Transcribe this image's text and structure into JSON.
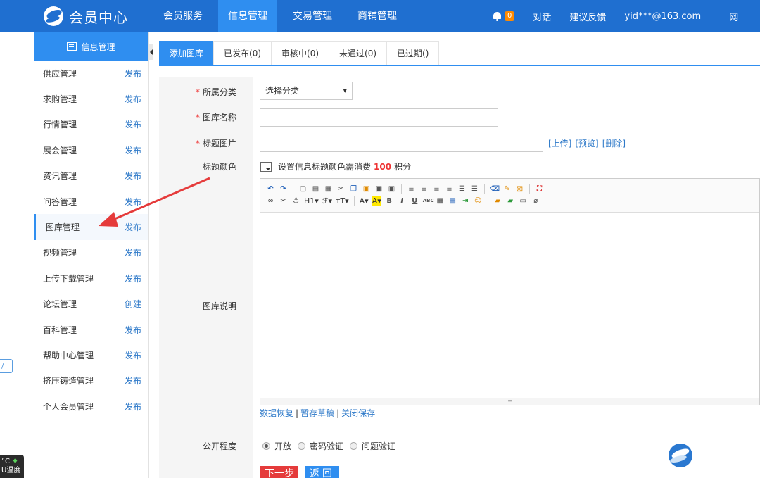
{
  "header": {
    "logo_text": "会员中心",
    "nav": [
      "会员服务",
      "信息管理",
      "交易管理",
      "商铺管理"
    ],
    "active_nav": "信息管理",
    "notification_count": "0",
    "chat": "对话",
    "feedback": "建议反馈",
    "user": "yid***@163.com",
    "overflow_char": "网"
  },
  "sidebar": {
    "title": "信息管理",
    "items": [
      {
        "label": "供应管理",
        "action": "发布"
      },
      {
        "label": "求购管理",
        "action": "发布"
      },
      {
        "label": "行情管理",
        "action": "发布"
      },
      {
        "label": "展会管理",
        "action": "发布"
      },
      {
        "label": "资讯管理",
        "action": "发布"
      },
      {
        "label": "问答管理",
        "action": "发布"
      },
      {
        "label": "图库管理",
        "action": "发布"
      },
      {
        "label": "视频管理",
        "action": "发布"
      },
      {
        "label": "上传下载管理",
        "action": "发布"
      },
      {
        "label": "论坛管理",
        "action": "创建"
      },
      {
        "label": "百科管理",
        "action": "发布"
      },
      {
        "label": "帮助中心管理",
        "action": "发布"
      },
      {
        "label": "挤压铸造管理",
        "action": "发布"
      },
      {
        "label": "个人会员管理",
        "action": "发布"
      }
    ],
    "active_item": "图库管理"
  },
  "tabs": [
    "添加图库",
    "已发布(0)",
    "审核中(0)",
    "未通过(0)",
    "已过期()"
  ],
  "form": {
    "required_mark": "*",
    "category_label": "所属分类",
    "category_value": "选择分类",
    "name_label": "图库名称",
    "name_value": "",
    "image_label": "标题图片",
    "image_value": "",
    "upload": "[上传]",
    "preview": "[预览]",
    "delete": "[删除]",
    "color_label": "标题颜色",
    "color_text_before": "设置信息标题颜色需消费",
    "color_points": "100",
    "color_text_after": "积分",
    "desc_label": "图库说明",
    "toolbar_h1": "H1",
    "editor_links": [
      "数据恢复",
      "暂存草稿",
      "关闭保存"
    ],
    "visibility_label": "公开程度",
    "visibility_options": [
      "开放",
      "密码验证",
      "问题验证"
    ],
    "visibility_selected": "开放",
    "next_button": "下一步",
    "back_button": "返回"
  },
  "edge": {
    "temp": "°C",
    "temp_label": "U温度"
  },
  "colors": {
    "primary": "#1f6fd0",
    "active": "#2f8ef0",
    "required": "#e33333",
    "next_button": "#e53b3b",
    "annotation_arrow": "#e53b3b"
  }
}
